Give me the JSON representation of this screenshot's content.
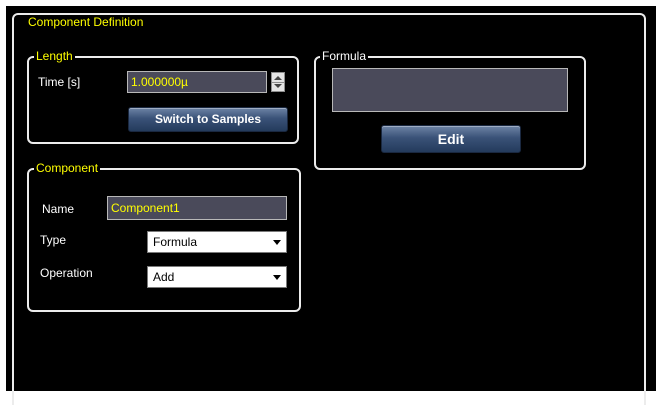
{
  "component_definition": {
    "title": "Component Definition"
  },
  "length": {
    "title": "Length",
    "time_label": "Time [s]",
    "time_value": "1.000000µ",
    "switch_button": "Switch to Samples"
  },
  "formula": {
    "title": "Formula",
    "value": "",
    "edit_button": "Edit"
  },
  "component": {
    "title": "Component",
    "name_label": "Name",
    "name_value": "Component1",
    "type_label": "Type",
    "type_value": "Formula",
    "operation_label": "Operation",
    "operation_value": "Add"
  },
  "colors": {
    "background": "#000000",
    "accent_text": "#ffff00",
    "frame": "#ececec",
    "button": "#3a5278"
  }
}
